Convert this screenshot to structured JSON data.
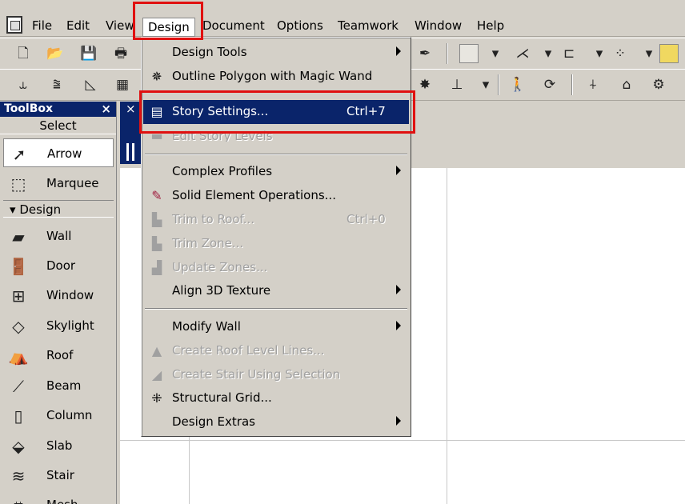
{
  "menubar": {
    "items": [
      "File",
      "Edit",
      "View",
      "Design",
      "Document",
      "Options",
      "Teamwork",
      "Window",
      "Help"
    ]
  },
  "design_menu": {
    "items": [
      {
        "label": "Design Tools",
        "shortcut": "",
        "submenu": true,
        "enabled": true,
        "icon": ""
      },
      {
        "label": "Outline Polygon with Magic Wand",
        "shortcut": "",
        "submenu": false,
        "enabled": true,
        "icon": "magic-wand-icon"
      },
      {
        "label": "Story Settings...",
        "shortcut": "Ctrl+7",
        "submenu": false,
        "enabled": true,
        "icon": "story-settings-icon",
        "highlighted": true
      },
      {
        "label": "Edit Story Levels",
        "shortcut": "",
        "submenu": false,
        "enabled": false,
        "icon": "story-levels-icon"
      },
      {
        "label": "Complex Profiles",
        "shortcut": "",
        "submenu": true,
        "enabled": true,
        "icon": ""
      },
      {
        "label": "Solid Element Operations...",
        "shortcut": "",
        "submenu": false,
        "enabled": true,
        "icon": "solid-ops-icon"
      },
      {
        "label": "Trim to Roof...",
        "shortcut": "Ctrl+0",
        "submenu": false,
        "enabled": false,
        "icon": "trim-roof-icon"
      },
      {
        "label": "Trim Zone...",
        "shortcut": "",
        "submenu": false,
        "enabled": false,
        "icon": "trim-zone-icon"
      },
      {
        "label": "Update Zones...",
        "shortcut": "",
        "submenu": false,
        "enabled": false,
        "icon": "update-zones-icon"
      },
      {
        "label": "Align 3D Texture",
        "shortcut": "",
        "submenu": true,
        "enabled": true,
        "icon": ""
      },
      {
        "label": "Modify Wall",
        "shortcut": "",
        "submenu": true,
        "enabled": true,
        "icon": ""
      },
      {
        "label": "Create Roof Level Lines...",
        "shortcut": "",
        "submenu": false,
        "enabled": false,
        "icon": "roof-level-icon"
      },
      {
        "label": "Create Stair Using Selection",
        "shortcut": "",
        "submenu": false,
        "enabled": false,
        "icon": "stair-selection-icon"
      },
      {
        "label": "Structural Grid...",
        "shortcut": "",
        "submenu": false,
        "enabled": true,
        "icon": "structural-grid-icon"
      },
      {
        "label": "Design Extras",
        "shortcut": "",
        "submenu": true,
        "enabled": true,
        "icon": ""
      }
    ]
  },
  "toolbox": {
    "title": "ToolBox",
    "close": "×",
    "select_label": "Select",
    "design_label": "Design",
    "tools": [
      {
        "label": "Arrow",
        "icon": "arrow-icon"
      },
      {
        "label": "Marquee",
        "icon": "marquee-icon"
      },
      {
        "label": "Wall",
        "icon": "wall-icon"
      },
      {
        "label": "Door",
        "icon": "door-icon"
      },
      {
        "label": "Window",
        "icon": "window-icon"
      },
      {
        "label": "Skylight",
        "icon": "skylight-icon"
      },
      {
        "label": "Roof",
        "icon": "roof-icon"
      },
      {
        "label": "Beam",
        "icon": "beam-icon"
      },
      {
        "label": "Column",
        "icon": "column-icon"
      },
      {
        "label": "Slab",
        "icon": "slab-icon"
      },
      {
        "label": "Stair",
        "icon": "stair-icon"
      },
      {
        "label": "Mesh",
        "icon": "mesh-icon"
      }
    ]
  },
  "colors": {
    "highlight": "#0a246a",
    "annotation": "#e01010",
    "menu_bg": "#d4d0c8"
  }
}
